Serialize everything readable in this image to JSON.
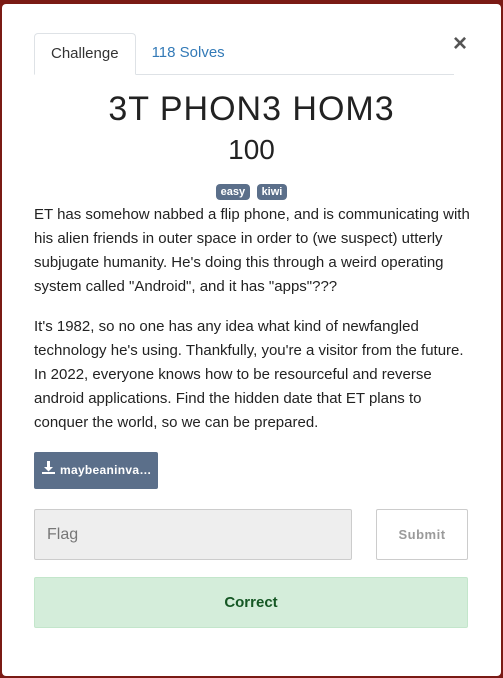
{
  "tabs": [
    {
      "label": "Challenge",
      "active": true
    },
    {
      "label": "118 Solves",
      "active": false
    }
  ],
  "close_label": "×",
  "challenge": {
    "title": "3T PHON3 HOM3",
    "points": "100",
    "tags": [
      "easy",
      "kiwi"
    ],
    "description": [
      "ET has somehow nabbed a flip phone, and is communicating with his alien friends in outer space in order to (we suspect) utterly subjugate humanity. He's doing this through a weird operating system called \"Android\", and it has \"apps\"???",
      "It's 1982, so no one has any idea what kind of newfangled technology he's using. Thankfully, you're a visitor from the future. In 2022, everyone knows how to be resourceful and reverse android applications. Find the hidden date that ET plans to conquer the world, so we can be prepared."
    ],
    "file_label": "maybeaninva…"
  },
  "form": {
    "flag_placeholder": "Flag",
    "flag_value": "",
    "submit_label": "Submit"
  },
  "result": {
    "text": "Correct"
  },
  "colors": {
    "backdrop": "#7a1a14",
    "tag_bg": "#5b6f8a",
    "link": "#337ab7",
    "success_bg": "#d4edda",
    "success_text": "#155724"
  },
  "icons": {
    "download": "download-icon",
    "close": "close-icon"
  }
}
